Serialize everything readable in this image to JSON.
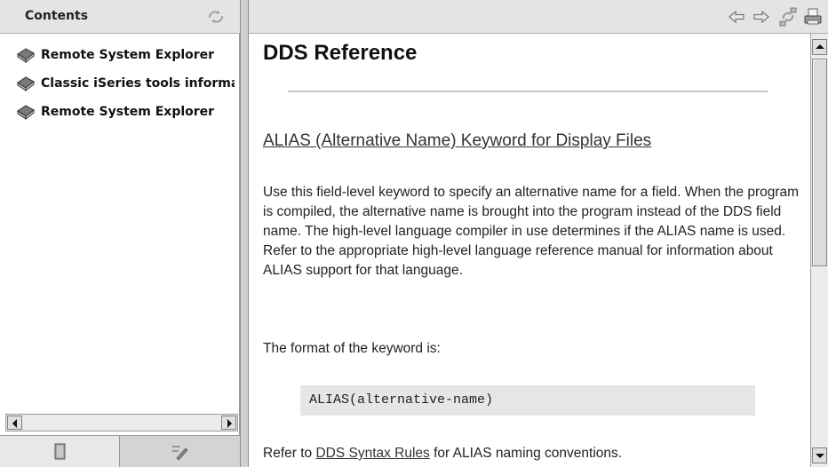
{
  "left_pane": {
    "title": "Contents",
    "tree_items": [
      {
        "label": "Remote System Explorer",
        "icon": "book-icon"
      },
      {
        "label": "Classic iSeries tools information",
        "icon": "book-icon"
      },
      {
        "label": "Remote System Explorer",
        "icon": "book-icon"
      }
    ],
    "tabs": [
      {
        "icon": "contents-tab-icon"
      },
      {
        "icon": "search-results-tab-icon"
      }
    ],
    "sync_icon": "link-with-contents-icon"
  },
  "toolbar": {
    "buttons": [
      {
        "icon": "back-arrow-icon"
      },
      {
        "icon": "forward-arrow-icon"
      },
      {
        "icon": "show-in-contents-icon"
      },
      {
        "icon": "print-icon"
      }
    ]
  },
  "document": {
    "title": "DDS Reference",
    "section_link": "ALIAS (Alternative Name) Keyword for Display Files",
    "paragraph": "Use this field-level keyword to specify an alternative name for a field. When the program is compiled, the alternative name is brought into the program instead of the DDS field name. The high-level language compiler in use determines if the ALIAS name is used. Refer to the appropriate high-level language reference manual for information about ALIAS support for that language.",
    "format_label": "The format of the keyword is:",
    "code": "ALIAS(alternative-name)",
    "refer_prefix": "Refer to",
    "refer_link": "DDS Syntax Rules",
    "refer_suffix": "for ALIAS naming conventions."
  },
  "colors": {
    "chrome": "#e4e4e4",
    "code_bg": "#e6e6e6"
  }
}
